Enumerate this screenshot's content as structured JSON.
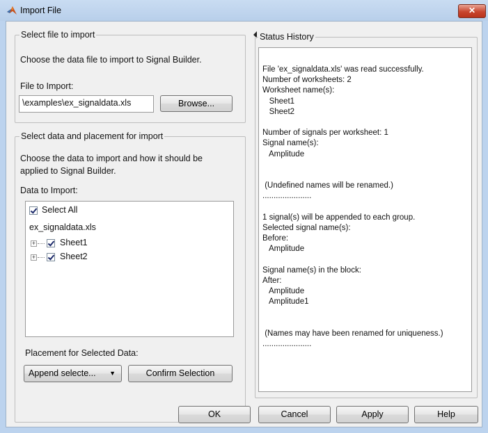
{
  "window": {
    "title": "Import File",
    "close_glyph": "✕"
  },
  "select_file": {
    "legend": "Select file to import",
    "description": "Choose the data file to import to Signal Builder.",
    "file_label": "File to Import:",
    "file_value": "\\examples\\ex_signaldata.xls",
    "browse_label": "Browse..."
  },
  "select_data": {
    "legend": "Select data and placement for import",
    "description_line1": "Choose the data to import and how it should be",
    "description_line2": "applied to Signal Builder.",
    "data_label": "Data to Import:",
    "select_all": "Select All",
    "file_node": "ex_signaldata.xls",
    "sheets": [
      "Sheet1",
      "Sheet2"
    ],
    "placement_label": "Placement for Selected Data:",
    "placement_value": "Append selecte...",
    "confirm_label": "Confirm Selection"
  },
  "status_history": {
    "legend": "Status History",
    "lines": [
      "File 'ex_signaldata.xls' was read successfully.",
      "Number of worksheets: 2",
      "Worksheet name(s):",
      "   Sheet1",
      "   Sheet2",
      "",
      "Number of signals per worksheet: 1",
      "Signal name(s):",
      "   Amplitude",
      "",
      "",
      " (Undefined names will be renamed.)",
      "......................",
      "",
      "1 signal(s) will be appended to each group.",
      "Selected signal name(s):",
      "Before:",
      "   Amplitude",
      "",
      "Signal name(s) in the block:",
      "After:",
      "   Amplitude",
      "   Amplitude1",
      "",
      "",
      " (Names may have been renamed for uniqueness.)",
      "......................"
    ]
  },
  "footer": {
    "ok": "OK",
    "cancel": "Cancel",
    "apply": "Apply",
    "help": "Help"
  }
}
